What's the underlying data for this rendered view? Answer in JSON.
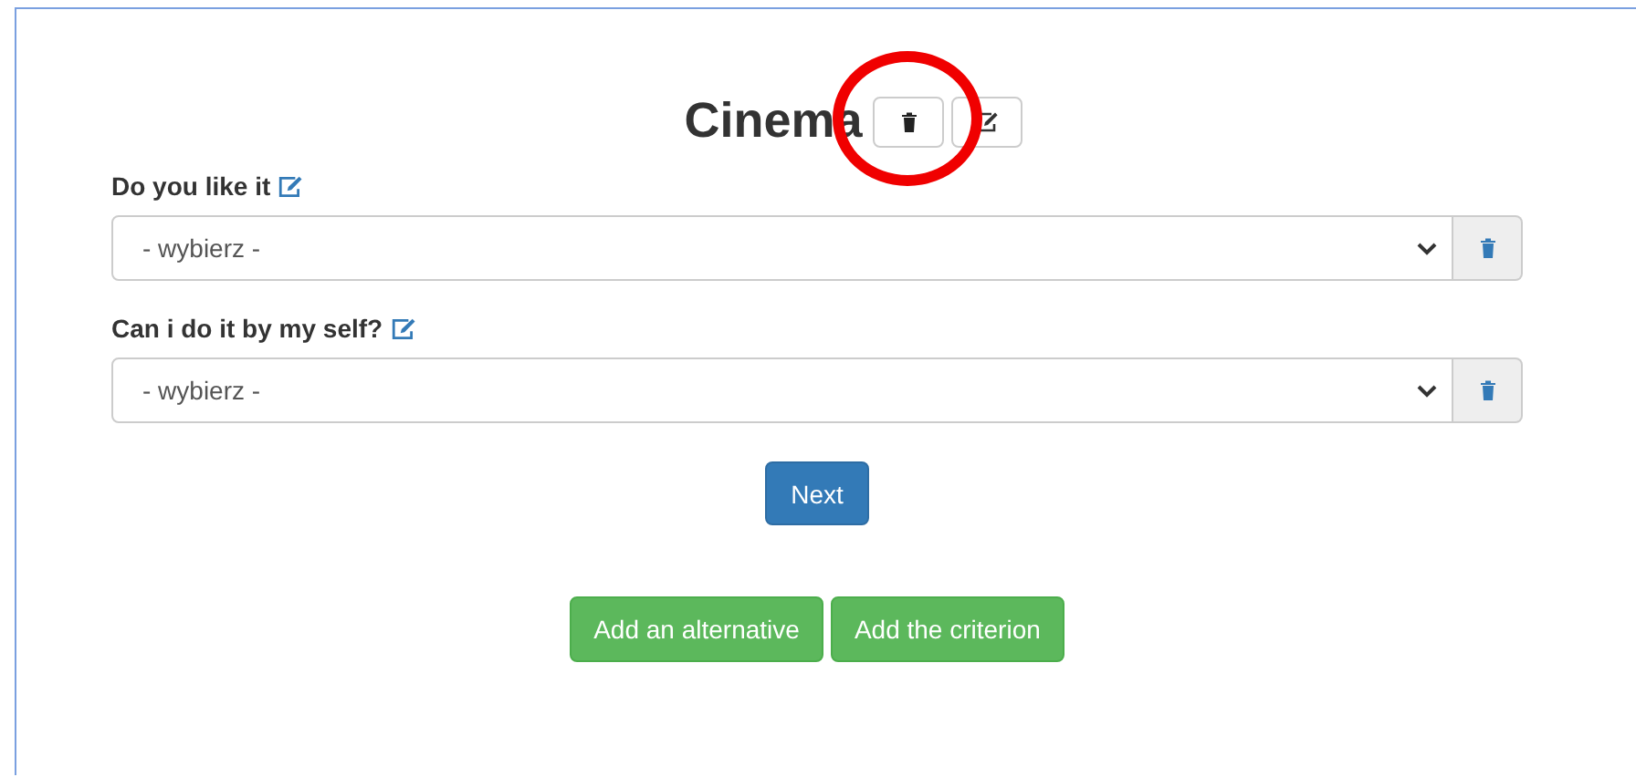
{
  "title": "Cinema",
  "questions": [
    {
      "label": "Do you like it",
      "placeholder": "- wybierz -"
    },
    {
      "label": "Can i do it by my self?",
      "placeholder": "- wybierz -"
    }
  ],
  "next_button": "Next",
  "actions": [
    "Add an alternative",
    "Add the criterion"
  ],
  "annotation": {
    "kind": "circle"
  }
}
